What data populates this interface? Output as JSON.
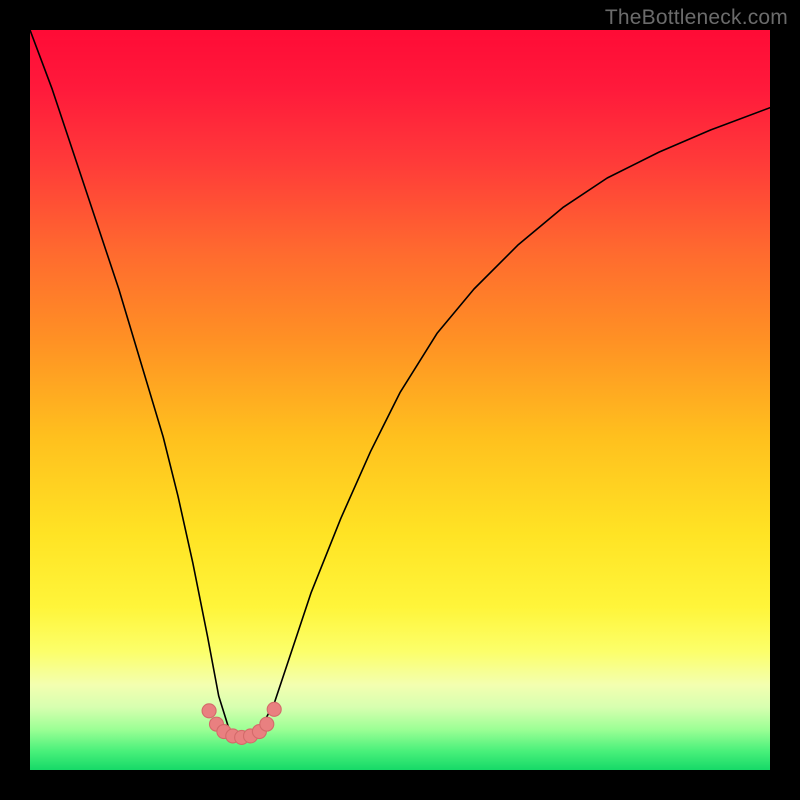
{
  "watermark": "TheBottleneck.com",
  "gradient": {
    "stops": [
      {
        "offset": 0.0,
        "color": "#ff0b36"
      },
      {
        "offset": 0.08,
        "color": "#ff1a3b"
      },
      {
        "offset": 0.18,
        "color": "#ff3b39"
      },
      {
        "offset": 0.3,
        "color": "#ff6a2f"
      },
      {
        "offset": 0.42,
        "color": "#ff9124"
      },
      {
        "offset": 0.55,
        "color": "#ffc01e"
      },
      {
        "offset": 0.68,
        "color": "#ffe324"
      },
      {
        "offset": 0.78,
        "color": "#fff53a"
      },
      {
        "offset": 0.84,
        "color": "#fcff6a"
      },
      {
        "offset": 0.885,
        "color": "#f3ffb0"
      },
      {
        "offset": 0.915,
        "color": "#d7ffb0"
      },
      {
        "offset": 0.945,
        "color": "#9cff95"
      },
      {
        "offset": 0.975,
        "color": "#48f07a"
      },
      {
        "offset": 1.0,
        "color": "#16d968"
      }
    ]
  },
  "chart_data": {
    "type": "line",
    "title": "",
    "xlabel": "",
    "ylabel": "",
    "xlim": [
      0,
      100
    ],
    "ylim": [
      0,
      100
    ],
    "grid": false,
    "legend": false,
    "series": [
      {
        "name": "bottleneck-curve",
        "color": "#000000",
        "stroke_width": 1.6,
        "x": [
          0,
          3,
          6,
          9,
          12,
          15,
          18,
          20,
          22,
          24,
          25.5,
          27,
          29,
          31,
          33,
          35,
          38,
          42,
          46,
          50,
          55,
          60,
          66,
          72,
          78,
          85,
          92,
          100
        ],
        "y": [
          100,
          92,
          83,
          74,
          65,
          55,
          45,
          37,
          28,
          18,
          10,
          5.2,
          4.6,
          5.4,
          9,
          15,
          24,
          34,
          43,
          51,
          59,
          65,
          71,
          76,
          80,
          83.5,
          86.5,
          89.5
        ]
      },
      {
        "name": "valley-marker",
        "type": "scatter",
        "color": "#e98080",
        "radius": 7,
        "stroke": "#d46a6a",
        "x": [
          24.2,
          25.2,
          26.2,
          27.4,
          28.6,
          29.8,
          31.0,
          32.0,
          33.0
        ],
        "y": [
          8.0,
          6.2,
          5.2,
          4.6,
          4.4,
          4.6,
          5.2,
          6.2,
          8.2
        ]
      }
    ]
  }
}
